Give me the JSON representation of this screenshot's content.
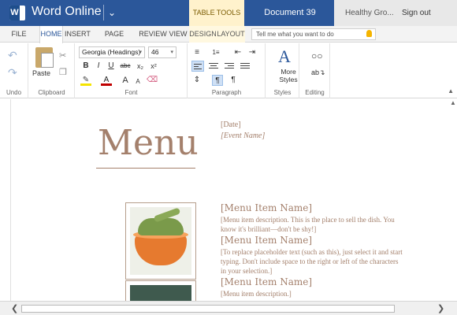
{
  "titlebar": {
    "app_name": "Word Online",
    "table_tools": "TABLE TOOLS",
    "document_title": "Document 39",
    "user_name": "Healthy Gro...",
    "sign_out": "Sign out"
  },
  "tabs": [
    "FILE",
    "HOME",
    "INSERT",
    "PAGE LAYOUT",
    "REVIEW",
    "VIEW",
    "DESIGN",
    "LAYOUT"
  ],
  "active_tab": "HOME",
  "tell_me_placeholder": "Tell me what you want to do",
  "ribbon": {
    "undo": {
      "label": "Undo"
    },
    "clipboard": {
      "paste_label": "Paste",
      "label": "Clipboard"
    },
    "font": {
      "name": "Georgia (Headings)",
      "size": "46",
      "label": "Font"
    },
    "paragraph": {
      "label": "Paragraph"
    },
    "styles": {
      "button_label": "More Styles",
      "label": "Styles"
    },
    "editing": {
      "label": "Editing"
    }
  },
  "document": {
    "title": "Menu",
    "date": "[Date]",
    "event_name": "[Event Name]",
    "items": [
      {
        "name": "[Menu Item Name]",
        "description": "[Menu item description. This is the place to sell the dish. You know it's brilliant—don't be shy!]"
      },
      {
        "name": "[Menu Item Name]",
        "description": "[To replace placeholder text (such as this), just select it and start typing. Don't include space to the right or left of the characters in your selection.]"
      },
      {
        "name": "[Menu Item Name]",
        "description": "[Menu item description.]"
      }
    ]
  },
  "colors": {
    "brand_blue": "#2b579a",
    "table_tools_bg": "#fff2cc",
    "menu_text": "#a4806c"
  }
}
